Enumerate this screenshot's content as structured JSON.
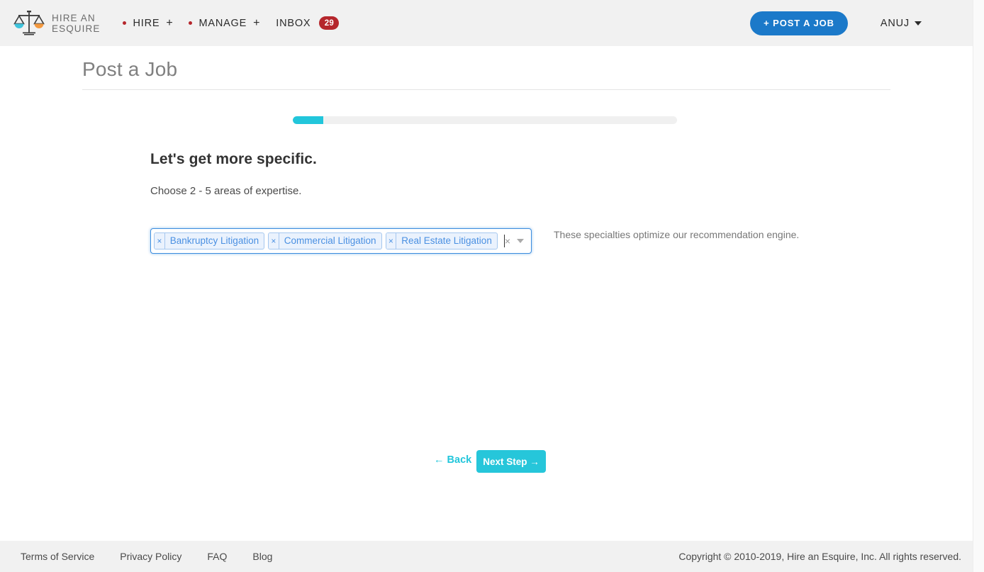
{
  "header": {
    "logo": {
      "icon": "scales-of-justice-icon",
      "line1": "HIRE AN",
      "line2": "ESQUIRE",
      "pan_left_color": "#3fc4dd",
      "pan_right_color": "#f4993f"
    },
    "nav": [
      {
        "label": "HIRE",
        "has_dot": true,
        "plus": "+"
      },
      {
        "label": "MANAGE",
        "has_dot": true,
        "plus": "+"
      },
      {
        "label": "INBOX",
        "has_dot": false,
        "badge": "29"
      }
    ],
    "post_job_label": "+ POST A JOB",
    "post_job_color": "#1b79c9",
    "user_label": "ANUJ",
    "badge_color": "#b5262c",
    "dot_color": "#b5262c"
  },
  "page": {
    "title": "Post a Job"
  },
  "progress": {
    "percent": 8,
    "fill_color": "#22c6db",
    "track_color": "#f0f0f0"
  },
  "form": {
    "headline": "Let's get more specific.",
    "subhead": "Choose 2 - 5 areas of expertise.",
    "help_text": "These specialties optimize our recommendation engine.",
    "select": {
      "placeholder": "",
      "tags": [
        {
          "label": "Bankruptcy Litigation",
          "remove": "×"
        },
        {
          "label": "Commercial Litigation",
          "remove": "×"
        },
        {
          "label": "Real Estate Litigation",
          "remove": "×"
        }
      ],
      "clear_all": "×",
      "tag_text_color": "#4a90e2",
      "tag_bg_color": "#eaf2fd",
      "focus_border_color": "#3c8dde"
    }
  },
  "navigation": {
    "back_label": "← Back",
    "next_label": "Next Step →",
    "accent_color": "#26c6da"
  },
  "footer": {
    "links": [
      {
        "label": "Terms of Service"
      },
      {
        "label": "Privacy Policy"
      },
      {
        "label": "FAQ"
      },
      {
        "label": "Blog"
      }
    ],
    "copyright": "Copyright © 2010-2019, Hire an Esquire, Inc. All rights reserved."
  }
}
